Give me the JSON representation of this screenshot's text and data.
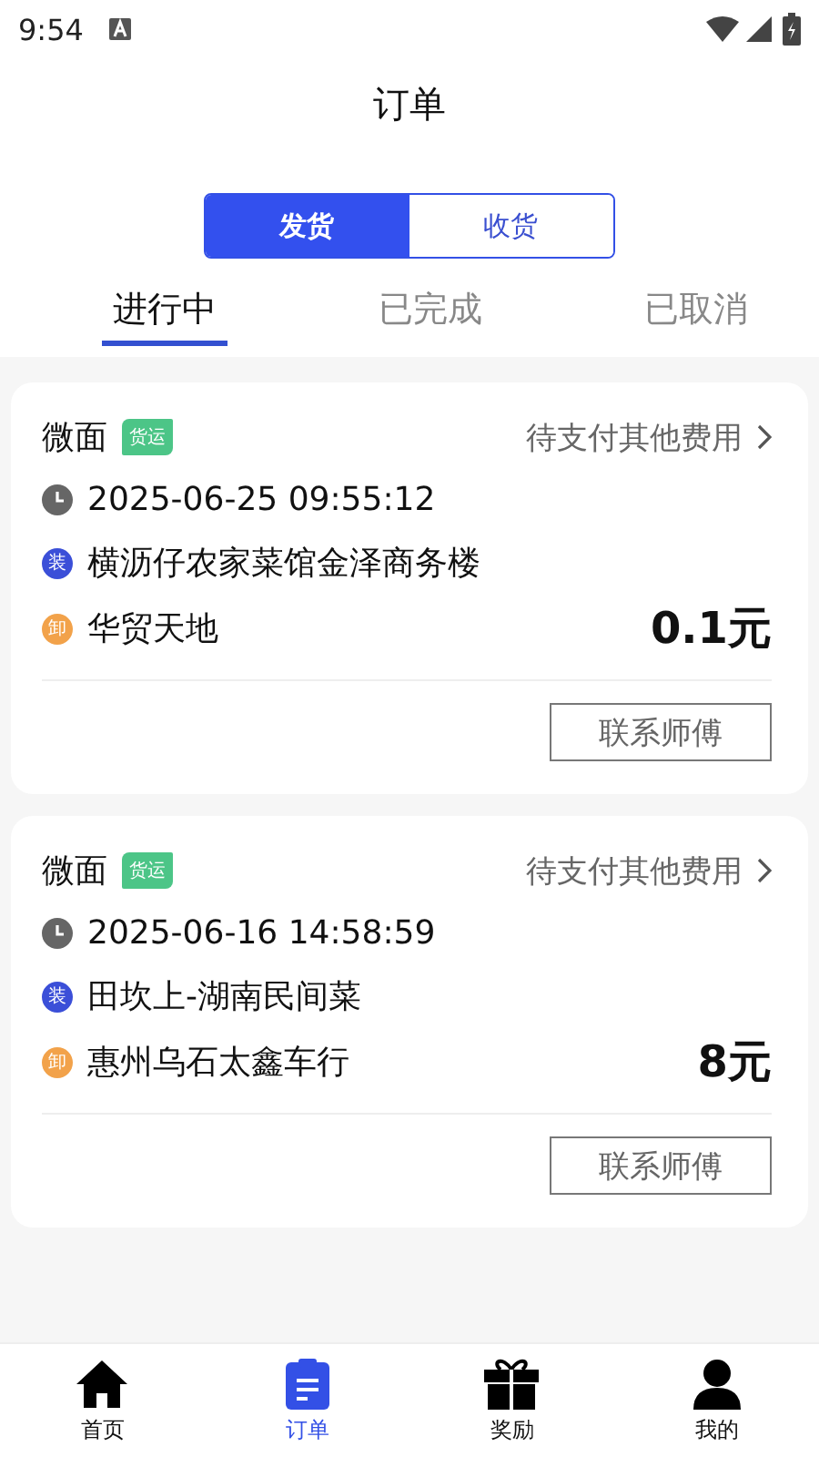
{
  "status_bar": {
    "time": "9:54"
  },
  "header": {
    "title": "订单"
  },
  "mode_switch": [
    {
      "label": "发货",
      "selected": true
    },
    {
      "label": "收货",
      "selected": false
    }
  ],
  "tabs": [
    {
      "label": "进行中",
      "selected": true
    },
    {
      "label": "已完成",
      "selected": false
    },
    {
      "label": "已取消",
      "selected": false
    }
  ],
  "orders": [
    {
      "vehicle": "微面",
      "tag": "货运",
      "status": "待支付其他费用",
      "time": "2025-06-25 09:55:12",
      "points": [
        {
          "kind": "load",
          "mark": "装",
          "address": "横沥仔农家菜馆金泽商务楼"
        },
        {
          "kind": "unload",
          "mark": "卸",
          "address": "华贸天地"
        }
      ],
      "price": "0.1元",
      "action": "联系师傅"
    },
    {
      "vehicle": "微面",
      "tag": "货运",
      "status": "待支付其他费用",
      "time": "2025-06-16 14:58:59",
      "points": [
        {
          "kind": "load",
          "mark": "装",
          "address": "田坎上-湖南民间菜"
        },
        {
          "kind": "unload",
          "mark": "卸",
          "address": "惠州乌石太鑫车行"
        }
      ],
      "price": "8元",
      "action": "联系师傅"
    }
  ],
  "bottom_nav": [
    {
      "kind": "home",
      "label": "首页",
      "selected": false
    },
    {
      "kind": "orders",
      "label": "订单",
      "selected": true
    },
    {
      "kind": "gift",
      "label": "奖励",
      "selected": false
    },
    {
      "kind": "profile",
      "label": "我的",
      "selected": false
    }
  ]
}
